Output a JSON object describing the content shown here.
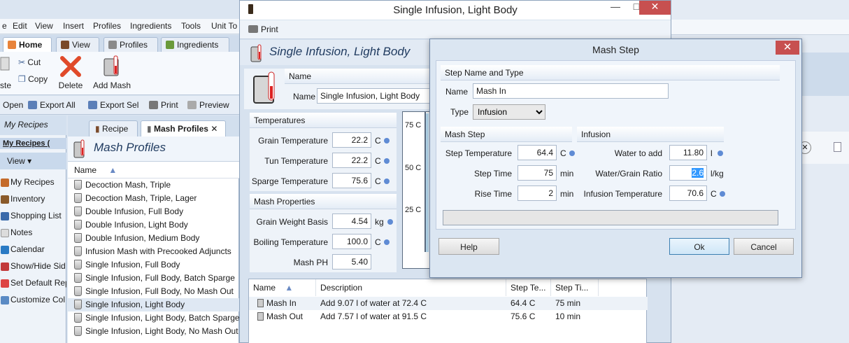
{
  "menu": [
    "e",
    "Edit",
    "View",
    "Insert",
    "Profiles",
    "Ingredients",
    "Tools",
    "Unit To"
  ],
  "ribbon_tabs": [
    "Home",
    "View",
    "Profiles",
    "Ingredients"
  ],
  "ribbon": {
    "paste": "ste",
    "cut": "Cut",
    "copy": "Copy",
    "delete": "Delete",
    "add_mash": "Add Mash"
  },
  "toolbar2": [
    "Open",
    "Export All",
    "Export Sel",
    "Print",
    "Preview"
  ],
  "nav": {
    "header": "My Recipes",
    "sub": "My Recipes (",
    "view": "View",
    "items": [
      "My Recipes",
      "Inventory",
      "Shopping List",
      "Notes",
      "Calendar",
      "Show/Hide Sid",
      "Set Default Rep",
      "Customize Col"
    ]
  },
  "list": {
    "tabs": [
      "Recipe",
      "Mash Profiles"
    ],
    "title": "Mash Profiles",
    "column": "Name",
    "rows": [
      "Decoction Mash, Triple",
      "Decoction Mash, Triple, Lager",
      "Double Infusion, Full Body",
      "Double Infusion, Light Body",
      "Double Infusion, Medium Body",
      "Infusion Mash with Precooked Adjuncts",
      "Single Infusion, Full Body",
      "Single Infusion, Full Body, Batch Sparge",
      "Single Infusion, Full Body, No Mash Out",
      "Single Infusion, Light Body",
      "Single Infusion, Light Body, Batch Sparge",
      "Single Infusion, Light Body, No Mash Out"
    ],
    "selected_index": 9
  },
  "profile_window": {
    "title": "Single Infusion, Light Body",
    "print": "Print",
    "header_title": "Single Infusion, Light Body",
    "name_section": "Name",
    "name_label": "Name",
    "name_value": "Single Infusion, Light Body",
    "temps_section": "Temperatures",
    "grain_temp_label": "Grain Temperature",
    "grain_temp": "22.2",
    "tun_temp_label": "Tun Temperature",
    "tun_temp": "22.2",
    "sparge_temp_label": "Sparge Temperature",
    "sparge_temp": "75.6",
    "unit_c": "C",
    "props_section": "Mash Properties",
    "grain_weight_label": "Grain Weight Basis",
    "grain_weight": "4.54",
    "unit_kg": "kg",
    "boiling_label": "Boiling Temperature",
    "boiling": "100.0",
    "ph_label": "Mash PH",
    "ph": "5.40",
    "chart_ticks": [
      "75 C",
      "50 C",
      "25 C"
    ],
    "table": {
      "headers": [
        "Name",
        "Description",
        "Step Te...",
        "Step Ti..."
      ],
      "rows": [
        [
          "Mash In",
          "Add 9.07 l of water at 72.4 C",
          "64.4 C",
          "75 min"
        ],
        [
          "Mash Out",
          "Add 7.57 l of water at 91.5 C",
          "75.6 C",
          "10 min"
        ]
      ]
    }
  },
  "dialog": {
    "title": "Mash Step",
    "name_type_section": "Step Name and Type",
    "name_label": "Name",
    "name_value": "Mash In",
    "type_label": "Type",
    "type_value": "Infusion",
    "mash_step_section": "Mash Step",
    "infusion_section": "Infusion",
    "step_temp_label": "Step Temperature",
    "step_temp": "64.4",
    "unit_c": "C",
    "step_time_label": "Step Time",
    "step_time": "75",
    "unit_min": "min",
    "rise_time_label": "Rise Time",
    "rise_time": "2",
    "water_add_label": "Water to add",
    "water_add": "11.80",
    "unit_l": "l",
    "ratio_label": "Water/Grain Ratio",
    "ratio": "2.6",
    "unit_lkg": "l/kg",
    "infusion_temp_label": "Infusion Temperature",
    "infusion_temp": "70.6",
    "help": "Help",
    "ok": "Ok",
    "cancel": "Cancel"
  },
  "colors": {
    "accent": "#5f8bd4",
    "close_red": "#c75050",
    "selection": "#3399ff"
  }
}
